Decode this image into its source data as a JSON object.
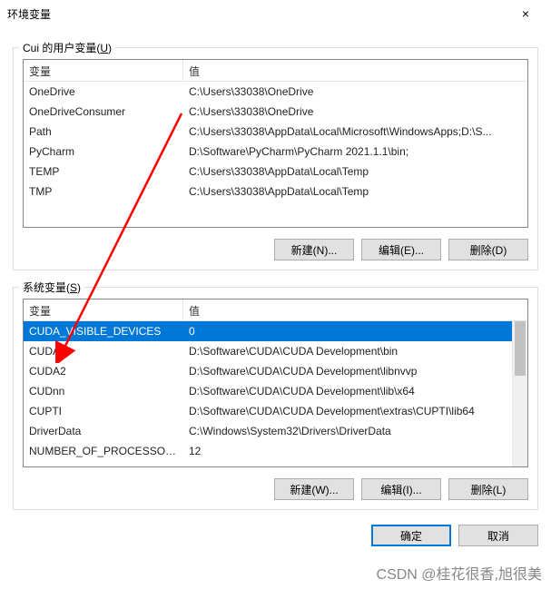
{
  "window": {
    "title": "环境变量",
    "close": "×"
  },
  "user_section": {
    "label_prefix": "Cui 的用户变量(",
    "label_key": "U",
    "label_suffix": ")",
    "headers": {
      "name": "变量",
      "value": "值"
    },
    "rows": [
      {
        "name": "OneDrive",
        "value": "C:\\Users\\33038\\OneDrive"
      },
      {
        "name": "OneDriveConsumer",
        "value": "C:\\Users\\33038\\OneDrive"
      },
      {
        "name": "Path",
        "value": "C:\\Users\\33038\\AppData\\Local\\Microsoft\\WindowsApps;D:\\S..."
      },
      {
        "name": "PyCharm",
        "value": "D:\\Software\\PyCharm\\PyCharm 2021.1.1\\bin;"
      },
      {
        "name": "TEMP",
        "value": "C:\\Users\\33038\\AppData\\Local\\Temp"
      },
      {
        "name": "TMP",
        "value": "C:\\Users\\33038\\AppData\\Local\\Temp"
      }
    ],
    "buttons": {
      "new": "新建(N)...",
      "edit": "编辑(E)...",
      "delete": "删除(D)"
    }
  },
  "sys_section": {
    "label_prefix": "系统变量(",
    "label_key": "S",
    "label_suffix": ")",
    "headers": {
      "name": "变量",
      "value": "值"
    },
    "rows": [
      {
        "name": "CUDA_VISIBLE_DEVICES",
        "value": "0",
        "selected": true
      },
      {
        "name": "CUDA1",
        "value": "D:\\Software\\CUDA\\CUDA Development\\bin"
      },
      {
        "name": "CUDA2",
        "value": "D:\\Software\\CUDA\\CUDA Development\\libnvvp"
      },
      {
        "name": "CUDnn",
        "value": "D:\\Software\\CUDA\\CUDA Development\\lib\\x64"
      },
      {
        "name": "CUPTI",
        "value": "D:\\Software\\CUDA\\CUDA Development\\extras\\CUPTI\\lib64"
      },
      {
        "name": "DriverData",
        "value": "C:\\Windows\\System32\\Drivers\\DriverData"
      },
      {
        "name": "NUMBER_OF_PROCESSORS",
        "value": "12"
      }
    ],
    "buttons": {
      "new": "新建(W)...",
      "edit": "编辑(I)...",
      "delete": "删除(L)"
    }
  },
  "footer": {
    "ok": "确定",
    "cancel": "取消"
  },
  "watermark": "CSDN @桂花很香,旭很美"
}
